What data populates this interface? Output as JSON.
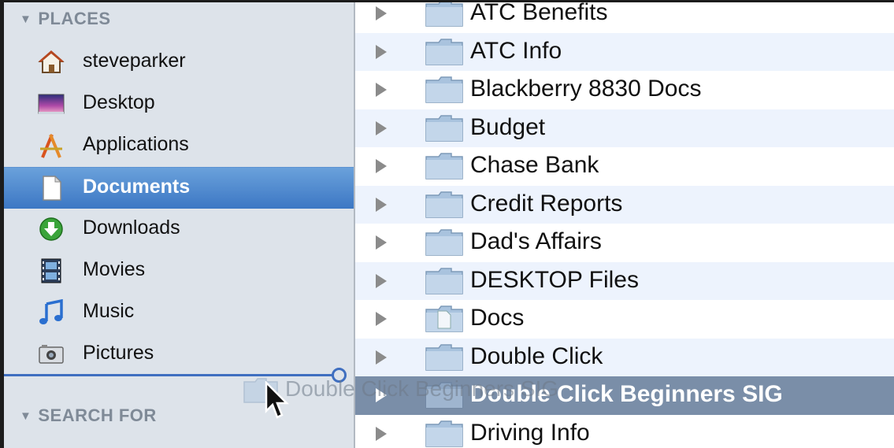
{
  "sidebar": {
    "places_header": "PLACES",
    "search_header": "SEARCH FOR",
    "items": [
      {
        "label": "steveparker",
        "icon": "home-icon"
      },
      {
        "label": "Desktop",
        "icon": "desktop-icon"
      },
      {
        "label": "Applications",
        "icon": "applications-icon"
      },
      {
        "label": "Documents",
        "icon": "documents-icon",
        "selected": true
      },
      {
        "label": "Downloads",
        "icon": "downloads-icon"
      },
      {
        "label": "Movies",
        "icon": "movies-icon"
      },
      {
        "label": "Music",
        "icon": "music-icon"
      },
      {
        "label": "Pictures",
        "icon": "pictures-icon"
      }
    ]
  },
  "drag": {
    "ghost_label": "Double Click Beginners SIG"
  },
  "files": {
    "rows": [
      {
        "name": "ATC Benefits"
      },
      {
        "name": "ATC Info"
      },
      {
        "name": "Blackberry 8830 Docs"
      },
      {
        "name": "Budget"
      },
      {
        "name": "Chase Bank"
      },
      {
        "name": "Credit Reports"
      },
      {
        "name": "Dad's Affairs"
      },
      {
        "name": "DESKTOP Files"
      },
      {
        "name": "Docs"
      },
      {
        "name": "Double Click"
      },
      {
        "name": "Double Click Beginners SIG",
        "selected": true
      },
      {
        "name": "Driving Info"
      }
    ]
  },
  "colors": {
    "sidebar_bg": "#dde3ea",
    "selection_sidebar": "#3c77c4",
    "selection_row": "#7a8ea8",
    "row_alt": "#edf3fd"
  }
}
